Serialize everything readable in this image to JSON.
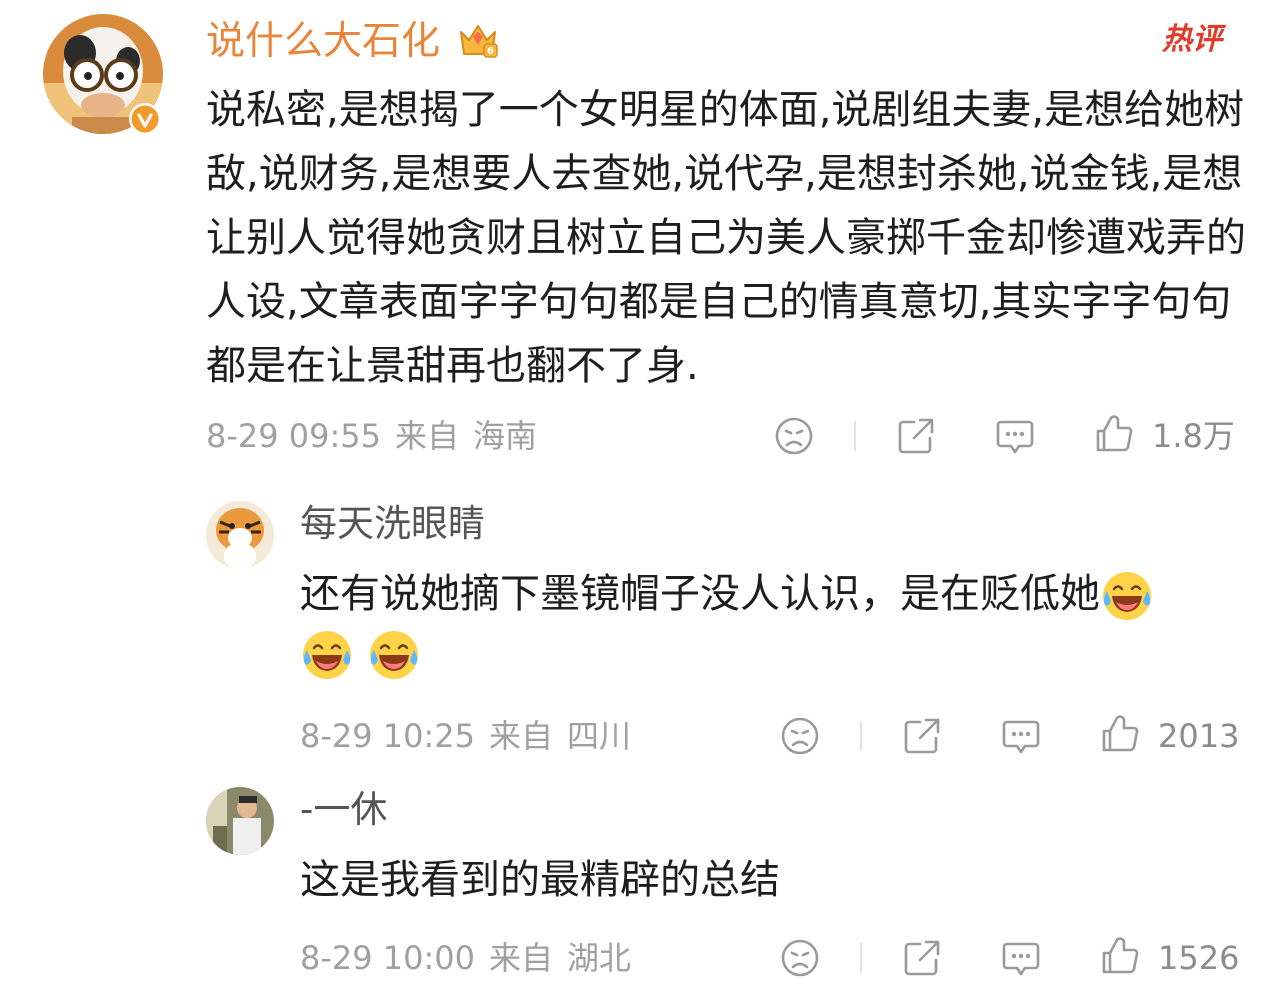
{
  "main_comment": {
    "username": "说什么大石化",
    "badge_icon": "crown-level-icon",
    "hot_label": "热评",
    "text": "说私密,是想揭了一个女明星的体面,说剧组夫妻,是想给她树敌,说财务,是想要人去查她,说代孕,是想封杀她,说金钱,是想让别人觉得她贪财且树立自己为美人豪掷千金却惨遭戏弄的人设,文章表面字字句句都是自己的情真意切,其实字字句句都是在让景甜再也翻不了身.",
    "time": "8-29 09:55",
    "from_label": "来自",
    "location": "海南",
    "likes": "1.8万",
    "verified_color": "#f39a2b"
  },
  "replies": [
    {
      "username": "每天洗眼睛",
      "text": "还有说她摘下墨镜帽子没人认识，是在贬低她",
      "emoji": "laughing-crying-emoji",
      "time": "8-29 10:25",
      "from_label": "来自",
      "location": "四川",
      "likes": "2013"
    },
    {
      "username": "-一休",
      "text": "这是我看到的最精辟的总结",
      "time": "8-29 10:00",
      "from_label": "来自",
      "location": "湖北",
      "likes": "1526"
    }
  ]
}
